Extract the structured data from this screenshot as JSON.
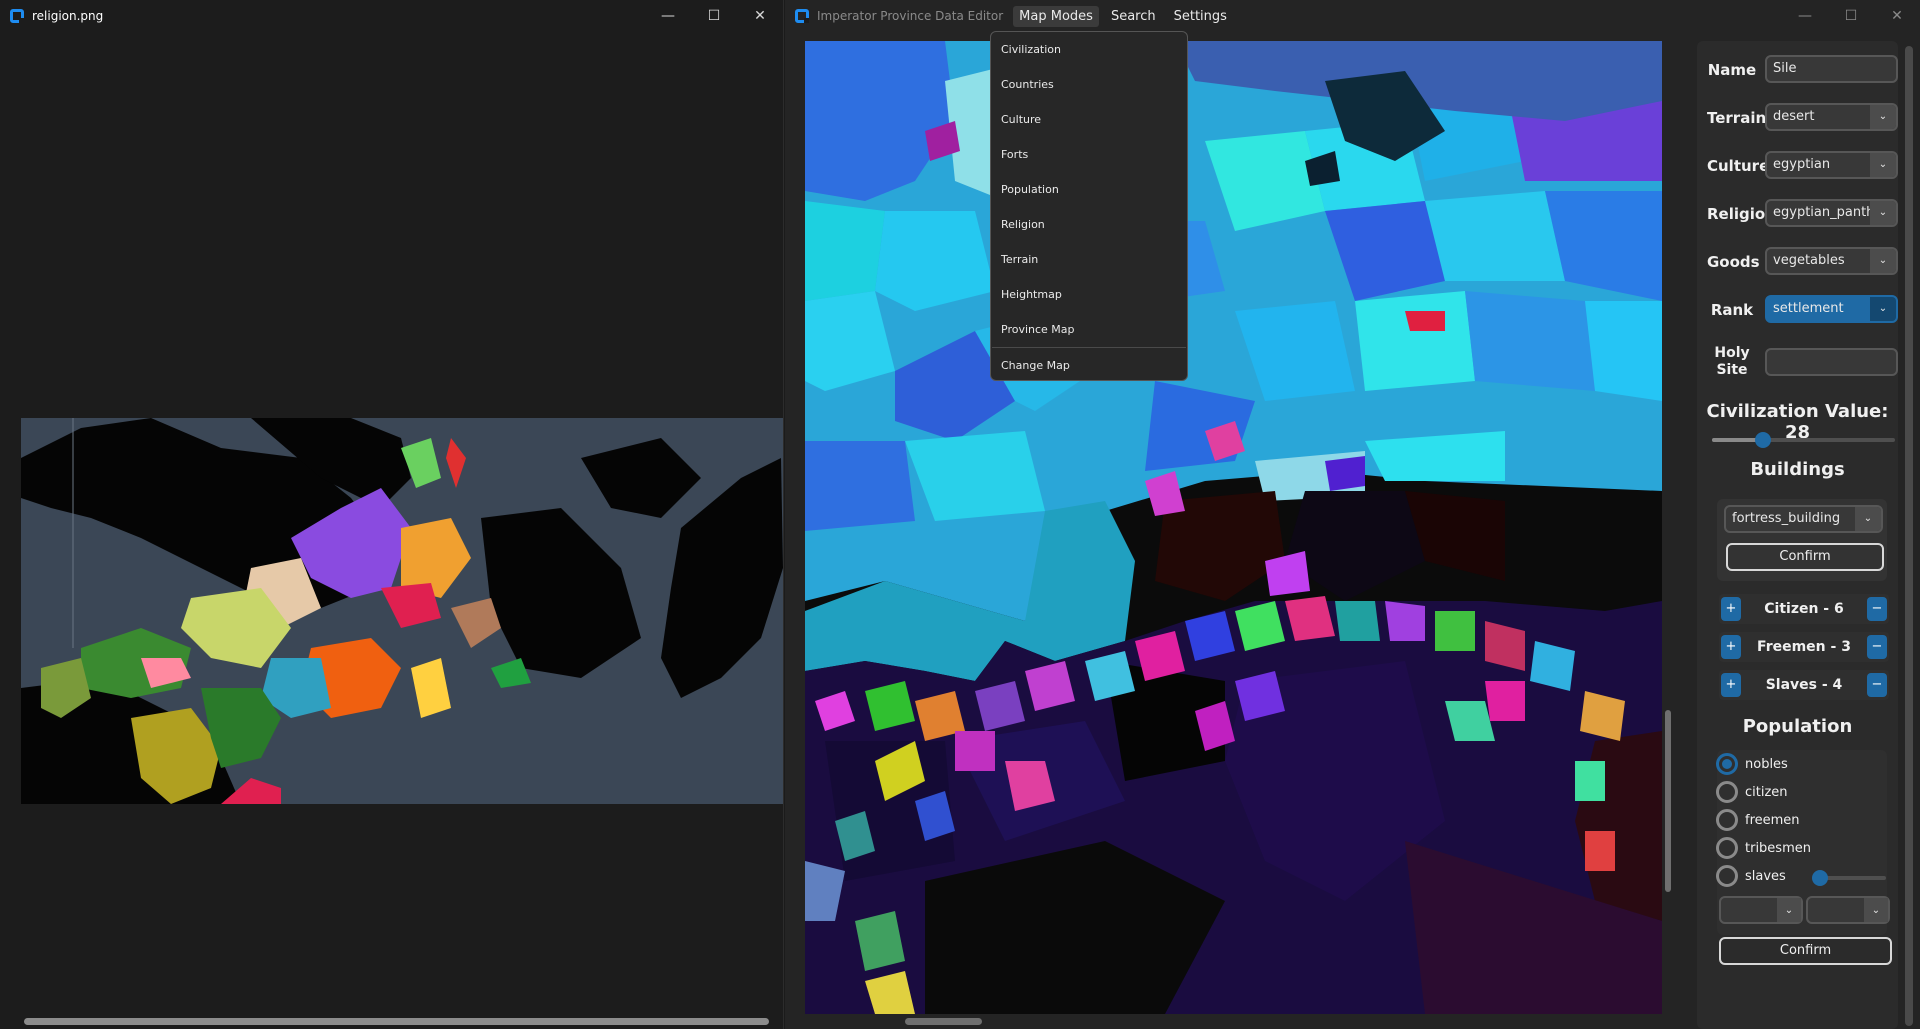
{
  "left_window": {
    "title": "religion.png",
    "controls": {
      "minimize": "—",
      "maximize": "☐",
      "close": "✕"
    }
  },
  "right_window": {
    "title": "Imperator Province Data Editor",
    "menu": {
      "map_modes": "Map Modes",
      "search": "Search",
      "settings": "Settings"
    },
    "controls": {
      "minimize": "—",
      "maximize": "☐",
      "close": "✕"
    },
    "map_modes_dropdown": [
      "Civilization",
      "Countries",
      "Culture",
      "Forts",
      "Population",
      "Religion",
      "Terrain",
      "Heightmap",
      "Province Map"
    ],
    "change_map": "Change Map"
  },
  "panel": {
    "fields": {
      "name": {
        "label": "Name",
        "value": "Sile"
      },
      "terrain": {
        "label": "Terrain",
        "value": "desert"
      },
      "culture": {
        "label": "Culture",
        "value": "egyptian"
      },
      "religion": {
        "label": "Religion",
        "value": "egyptian_pantheon"
      },
      "goods": {
        "label": "Goods",
        "value": "vegetables"
      },
      "rank": {
        "label": "Rank",
        "value": "settlement"
      },
      "holy_site": {
        "label": "Holy Site",
        "value": ""
      }
    },
    "civilization": {
      "label": "Civilization Value: 28",
      "level_fraction": 0.28
    },
    "buildings": {
      "heading": "Buildings",
      "selected": "fortress_building",
      "confirm": "Confirm"
    },
    "pops": [
      {
        "label": "Citizen - 6",
        "plus": "+",
        "minus": "−"
      },
      {
        "label": "Freemen - 3",
        "plus": "+",
        "minus": "−"
      },
      {
        "label": "Slaves - 4",
        "plus": "+",
        "minus": "−"
      }
    ],
    "population": {
      "heading": "Population",
      "options": [
        "nobles",
        "citizen",
        "freemen",
        "tribesmen",
        "slaves"
      ],
      "selected": "nobles",
      "slider_fraction": 0.0,
      "confirm": "Confirm"
    }
  },
  "icons": {
    "dropdown_caret": "chevron-down-icon",
    "app_icon": "app-icon"
  },
  "colors": {
    "accent": "#1f6aa5",
    "background": "#242424",
    "panel": "#2b2b2b"
  }
}
